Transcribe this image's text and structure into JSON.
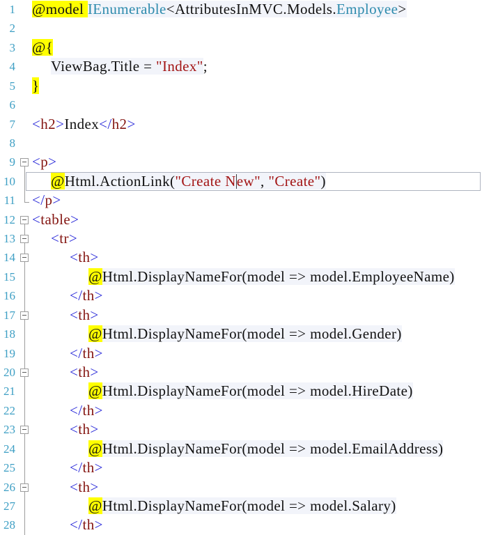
{
  "app": {
    "kind": "code-editor",
    "language": "razor-cshtml"
  },
  "colors": {
    "background": "#FFFFFF",
    "line_number": "#3E9FC4",
    "type_name": "#2E8BAD",
    "string_literal": "#A31515",
    "html_delimiter": "#2B2BD9",
    "html_tag_name": "#841511",
    "plain_text": "#111111",
    "razor_code_background": "#F2F4FA",
    "razor_transition_highlight": "#FFFF00",
    "outlining_gray": "#9C9C9C",
    "current_line_border": "#AEB4C0"
  },
  "editor": {
    "cursor": {
      "line": 10,
      "after_text": "\"Create N"
    },
    "lines": [
      {
        "n": 1,
        "ind": 0,
        "fold": "none",
        "segs": [
          {
            "t": "@model ",
            "k": "hl"
          },
          {
            "t": "IEnumerable",
            "k": "type",
            "band": true
          },
          {
            "t": "<AttributesInMVC.Models.",
            "k": "plain",
            "band": true
          },
          {
            "t": "Employee",
            "k": "type",
            "band": true
          },
          {
            "t": ">",
            "k": "plain",
            "band": true
          }
        ]
      },
      {
        "n": 2,
        "ind": 0,
        "fold": "none",
        "segs": []
      },
      {
        "n": 3,
        "ind": 0,
        "fold": "none",
        "segs": [
          {
            "t": "@{",
            "k": "hl"
          }
        ]
      },
      {
        "n": 4,
        "ind": 1,
        "fold": "none",
        "segs": [
          {
            "t": "ViewBag.Title = ",
            "k": "plain",
            "band": true
          },
          {
            "t": "\"Index\"",
            "k": "str",
            "band": true
          },
          {
            "t": ";",
            "k": "plain"
          }
        ]
      },
      {
        "n": 5,
        "ind": 0,
        "fold": "none",
        "segs": [
          {
            "t": "}",
            "k": "hl"
          }
        ]
      },
      {
        "n": 6,
        "ind": 0,
        "fold": "none",
        "segs": []
      },
      {
        "n": 7,
        "ind": 0,
        "fold": "none",
        "segs": [
          {
            "t": "<",
            "k": "delim"
          },
          {
            "t": "h2",
            "k": "tag"
          },
          {
            "t": ">",
            "k": "delim"
          },
          {
            "t": "Index",
            "k": "plain"
          },
          {
            "t": "</",
            "k": "delim"
          },
          {
            "t": "h2",
            "k": "tag"
          },
          {
            "t": ">",
            "k": "delim"
          }
        ]
      },
      {
        "n": 8,
        "ind": 0,
        "fold": "none",
        "segs": []
      },
      {
        "n": 9,
        "ind": 0,
        "fold": "box",
        "segs": [
          {
            "t": "<",
            "k": "delim"
          },
          {
            "t": "p",
            "k": "tag"
          },
          {
            "t": ">",
            "k": "delim"
          }
        ]
      },
      {
        "n": 10,
        "ind": 1,
        "fold": "line",
        "current": true,
        "segs": [
          {
            "t": "@",
            "k": "hl"
          },
          {
            "t": "Html.ActionLink(",
            "k": "plain",
            "band": true
          },
          {
            "t": "\"Create N",
            "k": "str",
            "band": true
          },
          {
            "cursor": true
          },
          {
            "t": "ew\"",
            "k": "str",
            "band": true
          },
          {
            "t": ", ",
            "k": "plain",
            "band": true
          },
          {
            "t": "\"Create\"",
            "k": "str",
            "band": true
          },
          {
            "t": ")",
            "k": "plain",
            "band": true
          }
        ]
      },
      {
        "n": 11,
        "ind": 0,
        "fold": "corner",
        "segs": [
          {
            "t": "</",
            "k": "delim"
          },
          {
            "t": "p",
            "k": "tag"
          },
          {
            "t": ">",
            "k": "delim"
          }
        ]
      },
      {
        "n": 12,
        "ind": 0,
        "fold": "box",
        "segs": [
          {
            "t": "<",
            "k": "delim"
          },
          {
            "t": "table",
            "k": "tag"
          },
          {
            "t": ">",
            "k": "delim"
          }
        ]
      },
      {
        "n": 13,
        "ind": 1,
        "fold": "boxmid",
        "segs": [
          {
            "t": "<",
            "k": "delim"
          },
          {
            "t": "tr",
            "k": "tag"
          },
          {
            "t": ">",
            "k": "delim"
          }
        ]
      },
      {
        "n": 14,
        "ind": 2,
        "fold": "boxmid",
        "segs": [
          {
            "t": "<",
            "k": "delim"
          },
          {
            "t": "th",
            "k": "tag"
          },
          {
            "t": ">",
            "k": "delim"
          }
        ]
      },
      {
        "n": 15,
        "ind": 3,
        "fold": "line",
        "segs": [
          {
            "t": "@",
            "k": "hl"
          },
          {
            "t": "Html.DisplayNameFor(model => model.EmployeeName)",
            "k": "plain",
            "band": true
          }
        ]
      },
      {
        "n": 16,
        "ind": 2,
        "fold": "line",
        "segs": [
          {
            "t": "</",
            "k": "delim"
          },
          {
            "t": "th",
            "k": "tag"
          },
          {
            "t": ">",
            "k": "delim"
          }
        ]
      },
      {
        "n": 17,
        "ind": 2,
        "fold": "boxmid",
        "segs": [
          {
            "t": "<",
            "k": "delim"
          },
          {
            "t": "th",
            "k": "tag"
          },
          {
            "t": ">",
            "k": "delim"
          }
        ]
      },
      {
        "n": 18,
        "ind": 3,
        "fold": "line",
        "segs": [
          {
            "t": "@",
            "k": "hl"
          },
          {
            "t": "Html.DisplayNameFor(model => model.Gender)",
            "k": "plain",
            "band": true
          }
        ]
      },
      {
        "n": 19,
        "ind": 2,
        "fold": "line",
        "segs": [
          {
            "t": "</",
            "k": "delim"
          },
          {
            "t": "th",
            "k": "tag"
          },
          {
            "t": ">",
            "k": "delim"
          }
        ]
      },
      {
        "n": 20,
        "ind": 2,
        "fold": "boxmid",
        "segs": [
          {
            "t": "<",
            "k": "delim"
          },
          {
            "t": "th",
            "k": "tag"
          },
          {
            "t": ">",
            "k": "delim"
          }
        ]
      },
      {
        "n": 21,
        "ind": 3,
        "fold": "line",
        "segs": [
          {
            "t": "@",
            "k": "hl"
          },
          {
            "t": "Html.DisplayNameFor(model => model.HireDate)",
            "k": "plain",
            "band": true
          }
        ]
      },
      {
        "n": 22,
        "ind": 2,
        "fold": "line",
        "segs": [
          {
            "t": "</",
            "k": "delim"
          },
          {
            "t": "th",
            "k": "tag"
          },
          {
            "t": ">",
            "k": "delim"
          }
        ]
      },
      {
        "n": 23,
        "ind": 2,
        "fold": "boxmid",
        "segs": [
          {
            "t": "<",
            "k": "delim"
          },
          {
            "t": "th",
            "k": "tag"
          },
          {
            "t": ">",
            "k": "delim"
          }
        ]
      },
      {
        "n": 24,
        "ind": 3,
        "fold": "line",
        "segs": [
          {
            "t": "@",
            "k": "hl"
          },
          {
            "t": "Html.DisplayNameFor(model => model.EmailAddress)",
            "k": "plain",
            "band": true
          }
        ]
      },
      {
        "n": 25,
        "ind": 2,
        "fold": "line",
        "segs": [
          {
            "t": "</",
            "k": "delim"
          },
          {
            "t": "th",
            "k": "tag"
          },
          {
            "t": ">",
            "k": "delim"
          }
        ]
      },
      {
        "n": 26,
        "ind": 2,
        "fold": "boxmid",
        "segs": [
          {
            "t": "<",
            "k": "delim"
          },
          {
            "t": "th",
            "k": "tag"
          },
          {
            "t": ">",
            "k": "delim"
          }
        ]
      },
      {
        "n": 27,
        "ind": 3,
        "fold": "line",
        "segs": [
          {
            "t": "@",
            "k": "hl"
          },
          {
            "t": "Html.DisplayNameFor(model => model.Salary)",
            "k": "plain",
            "band": true
          }
        ]
      },
      {
        "n": 28,
        "ind": 2,
        "fold": "line",
        "segs": [
          {
            "t": "</",
            "k": "delim"
          },
          {
            "t": "th",
            "k": "tag"
          },
          {
            "t": ">",
            "k": "delim"
          }
        ]
      }
    ]
  }
}
